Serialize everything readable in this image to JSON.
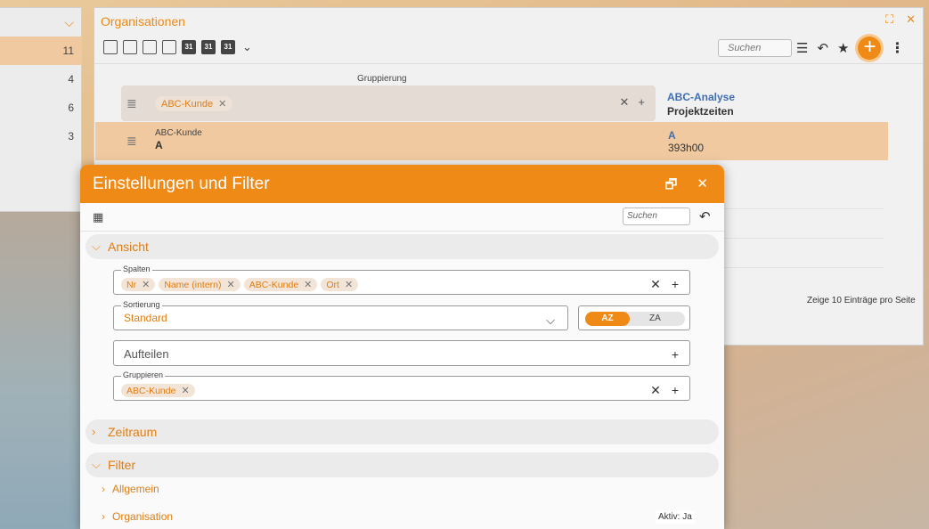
{
  "left_panel": {
    "counts": [
      "11",
      "4",
      "6",
      "3"
    ]
  },
  "org_window": {
    "title": "Organisationen",
    "search_placeholder": "Suchen",
    "toolbar_calendar_label": "31",
    "grouping_label": "Gruppierung",
    "grouping_chip": "ABC-Kunde",
    "col2_header_line1": "ABC-Analyse",
    "col2_header_line2": "Projektzeiten",
    "selected_row": {
      "label": "ABC-Kunde",
      "value": "A",
      "col2_value": "A",
      "col2_time": "393h00"
    },
    "pager": "Zeige  10  Einträge pro Seite"
  },
  "dialog": {
    "title": "Einstellungen und Filter",
    "search_placeholder": "Suchen",
    "sections": {
      "ansicht": "Ansicht",
      "zeitraum": "Zeitraum",
      "filter": "Filter"
    },
    "spalten": {
      "label": "Spalten",
      "chips": [
        "Nr",
        "Name (intern)",
        "ABC-Kunde",
        "Ort"
      ]
    },
    "sortierung": {
      "label": "Sortierung",
      "value": "Standard",
      "az": "AZ",
      "za": "ZA"
    },
    "aufteilen": {
      "placeholder": "Aufteilen"
    },
    "gruppieren": {
      "label": "Gruppieren",
      "chips": [
        "ABC-Kunde"
      ]
    },
    "filter_items": {
      "allgemein": "Allgemein",
      "organisation": "Organisation",
      "aktiv_badge": "Aktiv: Ja"
    }
  }
}
